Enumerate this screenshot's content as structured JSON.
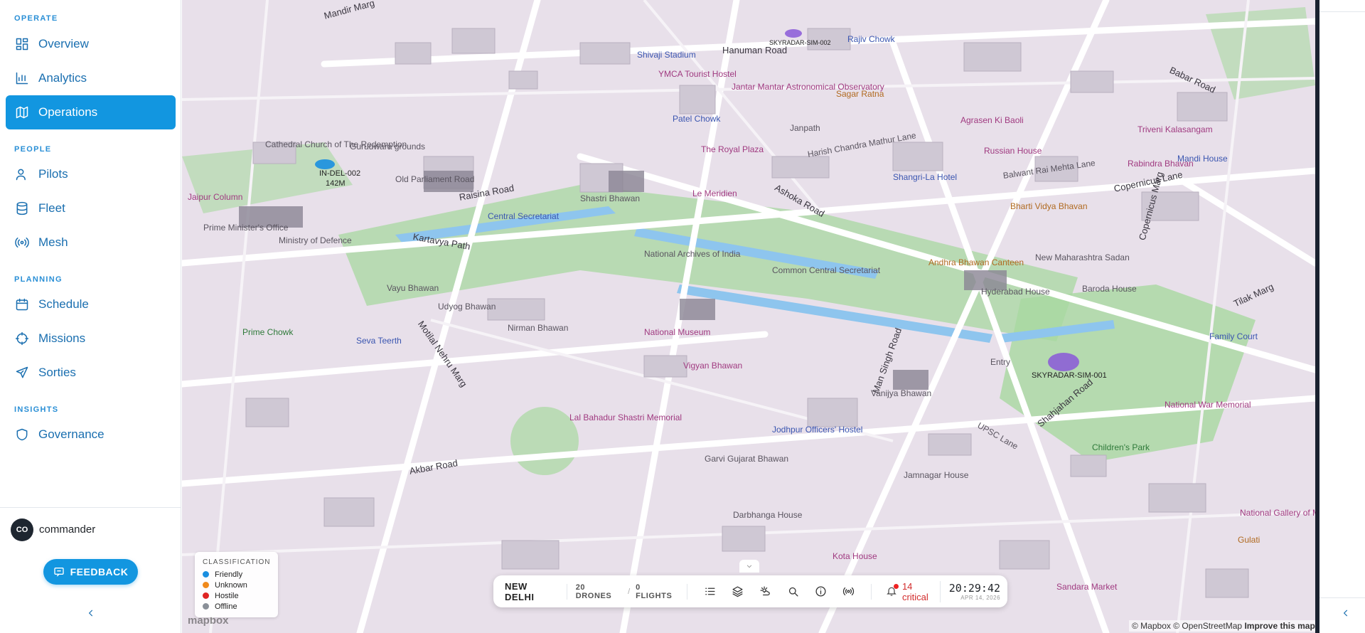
{
  "sidebar": {
    "sections": [
      {
        "label": "OPERATE",
        "items": [
          {
            "label": "Overview",
            "icon": "grid-icon",
            "active": false
          },
          {
            "label": "Analytics",
            "icon": "bar-chart-icon",
            "active": false
          },
          {
            "label": "Operations",
            "icon": "map-icon",
            "active": true
          }
        ]
      },
      {
        "label": "PEOPLE",
        "items": [
          {
            "label": "Pilots",
            "icon": "user-icon",
            "active": false
          },
          {
            "label": "Fleet",
            "icon": "database-icon",
            "active": false
          },
          {
            "label": "Mesh",
            "icon": "radio-icon",
            "active": false
          }
        ]
      },
      {
        "label": "PLANNING",
        "items": [
          {
            "label": "Schedule",
            "icon": "calendar-icon",
            "active": false
          },
          {
            "label": "Missions",
            "icon": "target-icon",
            "active": false
          },
          {
            "label": "Sorties",
            "icon": "plane-icon",
            "active": false
          }
        ]
      },
      {
        "label": "INSIGHTS",
        "items": [
          {
            "label": "Governance",
            "icon": "shield-icon",
            "active": false
          }
        ]
      }
    ],
    "user": {
      "initials": "CO",
      "name": "commander"
    },
    "feedback_label": "FEEDBACK"
  },
  "map": {
    "labels": [
      {
        "text": "Mandir Marg"
      },
      {
        "text": "Hanuman Road"
      },
      {
        "text": "Babar Road"
      },
      {
        "text": "Shivaji Stadium"
      },
      {
        "text": "YMCA Tourist Hostel"
      },
      {
        "text": "Patel Chowk"
      },
      {
        "text": "Janpath"
      },
      {
        "text": "The Royal Plaza"
      },
      {
        "text": "Harish Chandra Mathur Lane"
      },
      {
        "text": "Raisina Road"
      },
      {
        "text": "Central Secretariat"
      },
      {
        "text": "Shastri Bhawan"
      },
      {
        "text": "Kartavya Path"
      },
      {
        "text": "National Archives of India"
      },
      {
        "text": "Le Meridien"
      },
      {
        "text": "Ashoka Road"
      },
      {
        "text": "Common Central Secretariat"
      },
      {
        "text": "Vayu Bhawan"
      },
      {
        "text": "Udyog Bhawan"
      },
      {
        "text": "Nirman Bhawan"
      },
      {
        "text": "National Museum"
      },
      {
        "text": "Vigyan Bhawan"
      },
      {
        "text": "Motilal Nehru Marg"
      },
      {
        "text": "Seva Teerth"
      },
      {
        "text": "Prime Chowk"
      },
      {
        "text": "Man Singh Road"
      },
      {
        "text": "Vanijya Bhawan"
      },
      {
        "text": "Entry"
      },
      {
        "text": "Lal Bahadur Shastri Memorial"
      },
      {
        "text": "Jodhpur Officers' Hostel"
      },
      {
        "text": "Akbar Road"
      },
      {
        "text": "Garvi Gujarat Bhawan"
      },
      {
        "text": "Jamnagar House"
      },
      {
        "text": "Darbhanga House"
      },
      {
        "text": "Kota House"
      },
      {
        "text": "Shahjahan Road"
      },
      {
        "text": "UPSC Lane"
      },
      {
        "text": "Children's Park"
      },
      {
        "text": "National War Memorial"
      },
      {
        "text": "Hyderabad House"
      },
      {
        "text": "Baroda House"
      },
      {
        "text": "Tilak Marg"
      },
      {
        "text": "Family Court"
      },
      {
        "text": "Copernicus Marg"
      },
      {
        "text": "Copernicus Lane"
      },
      {
        "text": "Bharti Vidya Bhavan"
      },
      {
        "text": "Balwant Rai Mehta Lane"
      },
      {
        "text": "Russian House"
      },
      {
        "text": "Andhra Bhawan Canteen"
      },
      {
        "text": "New Maharashtra Sadan"
      },
      {
        "text": "Cathedral Church of The Redemption"
      },
      {
        "text": "Old Parliament Road"
      },
      {
        "text": "Gurudwara grounds"
      },
      {
        "text": "Prime Minister's Office"
      },
      {
        "text": "Ministry of Defence"
      },
      {
        "text": "Jaipur Column"
      },
      {
        "text": "National Gallery of Modern Art"
      },
      {
        "text": "Sandara Market"
      },
      {
        "text": "Gulati"
      },
      {
        "text": "Shangri-La Hotel"
      },
      {
        "text": "Agrasen Ki Baoli"
      },
      {
        "text": "Triveni Kalasangam"
      },
      {
        "text": "Rabindra Bhavan"
      },
      {
        "text": "Mandi House"
      },
      {
        "text": "Sagar Ratna"
      },
      {
        "text": "Rajiv Chowk"
      },
      {
        "text": "Jantar Mantar Astronomical Observatory"
      }
    ],
    "drones": [
      {
        "id": "SKYRADAR-SIM-001",
        "color": "#8a58d8"
      },
      {
        "id": "IN-DEL-002",
        "alt": "142m",
        "color": "#1a8fe0"
      },
      {
        "id": "SKYRADAR-SIM-002",
        "color": "#8a58d8"
      }
    ],
    "attribution": {
      "mapbox": "© Mapbox",
      "osm": "© OpenStreetMap",
      "improve": "Improve this map"
    },
    "logo": "mapbox"
  },
  "legend": {
    "title": "CLASSIFICATION",
    "items": [
      {
        "label": "Friendly",
        "color": "#1a8fe0"
      },
      {
        "label": "Unknown",
        "color": "#f08a1c"
      },
      {
        "label": "Hostile",
        "color": "#e02424"
      },
      {
        "label": "Offline",
        "color": "#8a8f98"
      }
    ]
  },
  "toolbar": {
    "city": "NEW DELHI",
    "drones": "20 DRONES",
    "flights": "0 FLIGHTS",
    "alert_text": "14 critical",
    "time": "20:29:42",
    "date": "APR 14, 2026",
    "buttons": [
      "list-icon",
      "layers-icon",
      "weather-icon",
      "search-icon",
      "info-icon",
      "signal-icon"
    ]
  }
}
